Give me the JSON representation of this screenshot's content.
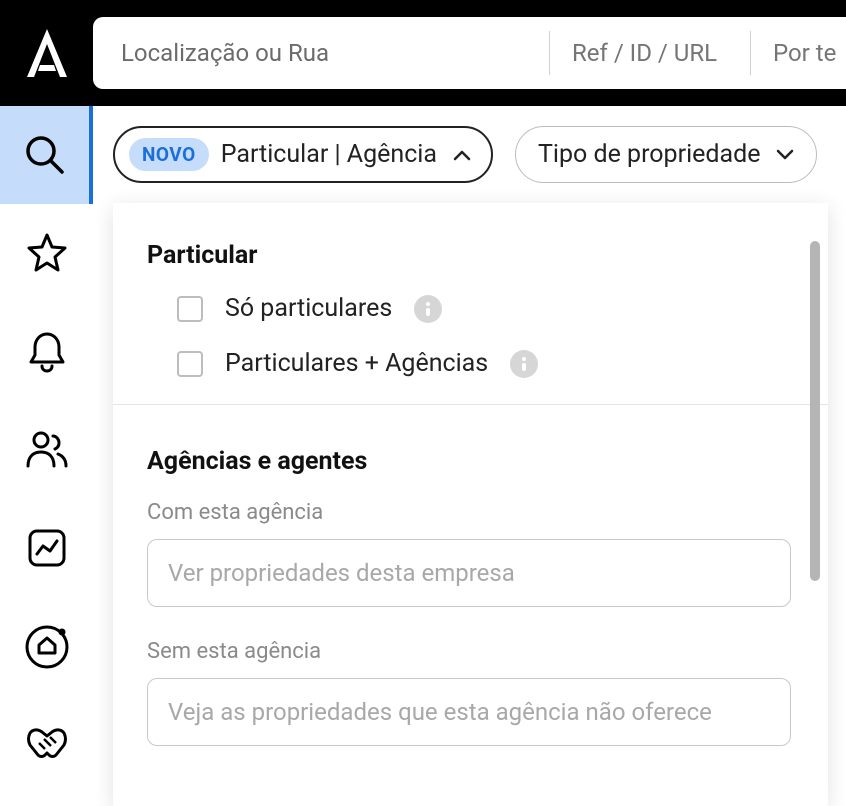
{
  "header": {
    "search_location_placeholder": "Localização ou Rua",
    "search_ref_placeholder": "Ref / ID / URL",
    "search_type_placeholder": "Por te"
  },
  "filters": {
    "badge": "NOVO",
    "particular_agency_label": "Particular | Agência",
    "property_type_label": "Tipo de propriedade"
  },
  "panel": {
    "section1_title": "Particular",
    "option1_label": "Só particulares",
    "option2_label": "Particulares + Agências",
    "section2_title": "Agências e agentes",
    "field1_label": "Com esta agência",
    "field1_placeholder": "Ver propriedades desta empresa",
    "field2_label": "Sem esta agência",
    "field2_placeholder": "Veja as propriedades que esta agência não oferece"
  }
}
